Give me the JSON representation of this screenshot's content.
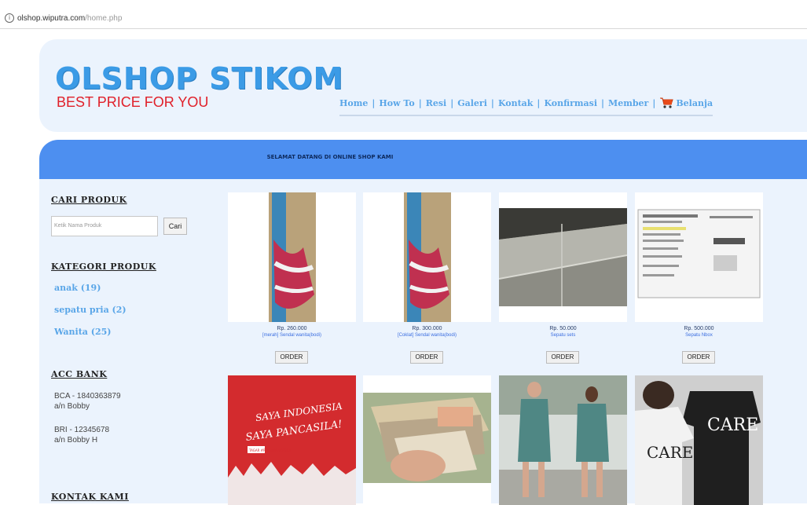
{
  "browser": {
    "url_host": "olshop.wiputra.com",
    "url_path": "/home.php"
  },
  "header": {
    "logo_title": "OLSHOP STIKOM",
    "logo_tagline": "BEST PRICE FOR YOU",
    "nav": [
      "Home",
      "How To",
      "Resi",
      "Galeri",
      "Kontak",
      "Konfirmasi",
      "Member"
    ],
    "cart_label": "Belanja"
  },
  "banner": {
    "text": "SELAMAT DATANG DI ONLINE SHOP KAMI"
  },
  "sidebar": {
    "search_heading": "CARI PRODUK",
    "search_placeholder": "Ketik Nama Produk",
    "search_button": "Cari",
    "category_heading": "KATEGORI PRODUK",
    "categories": [
      "anak (19)",
      "sepatu pria (2)",
      "Wanita (25)"
    ],
    "bank_heading": "ACC BANK",
    "banks": [
      {
        "line1": "BCA - 1840363879",
        "line2": "a/n Bobby"
      },
      {
        "line1": "BRI - 12345678",
        "line2": "a/n Bobby H"
      }
    ],
    "contact_heading": "KONTAK KAMI"
  },
  "products": [
    {
      "price": "Rp. 260.000",
      "name": "[merah] Sendal wanita(bodi)",
      "order": "ORDER"
    },
    {
      "price": "Rp. 300.000",
      "name": "[Coklat] Sendal wanita(bodi)",
      "order": "ORDER"
    },
    {
      "price": "Rp. 50.000",
      "name": "Sepatu sets",
      "order": "ORDER"
    },
    {
      "price": "Rp. 500.000",
      "name": "Sepatu Nbox",
      "order": "ORDER"
    }
  ],
  "row2_products": [
    {
      "image_text_1": "SAYA INDONESIA",
      "image_text_2": "SAYA PANCASILA!",
      "image_badge": "TAGAR #PEKANPANCASILA"
    },
    {},
    {},
    {
      "image_text_1": "CARE",
      "image_text_2": "CARE"
    }
  ],
  "colors": {
    "accent_blue": "#4d8ff0",
    "link_blue": "#5aa6e8",
    "logo_blue": "#3b9be6",
    "tagline_red": "#e0202a",
    "panel_bg": "#ebf3fd"
  }
}
